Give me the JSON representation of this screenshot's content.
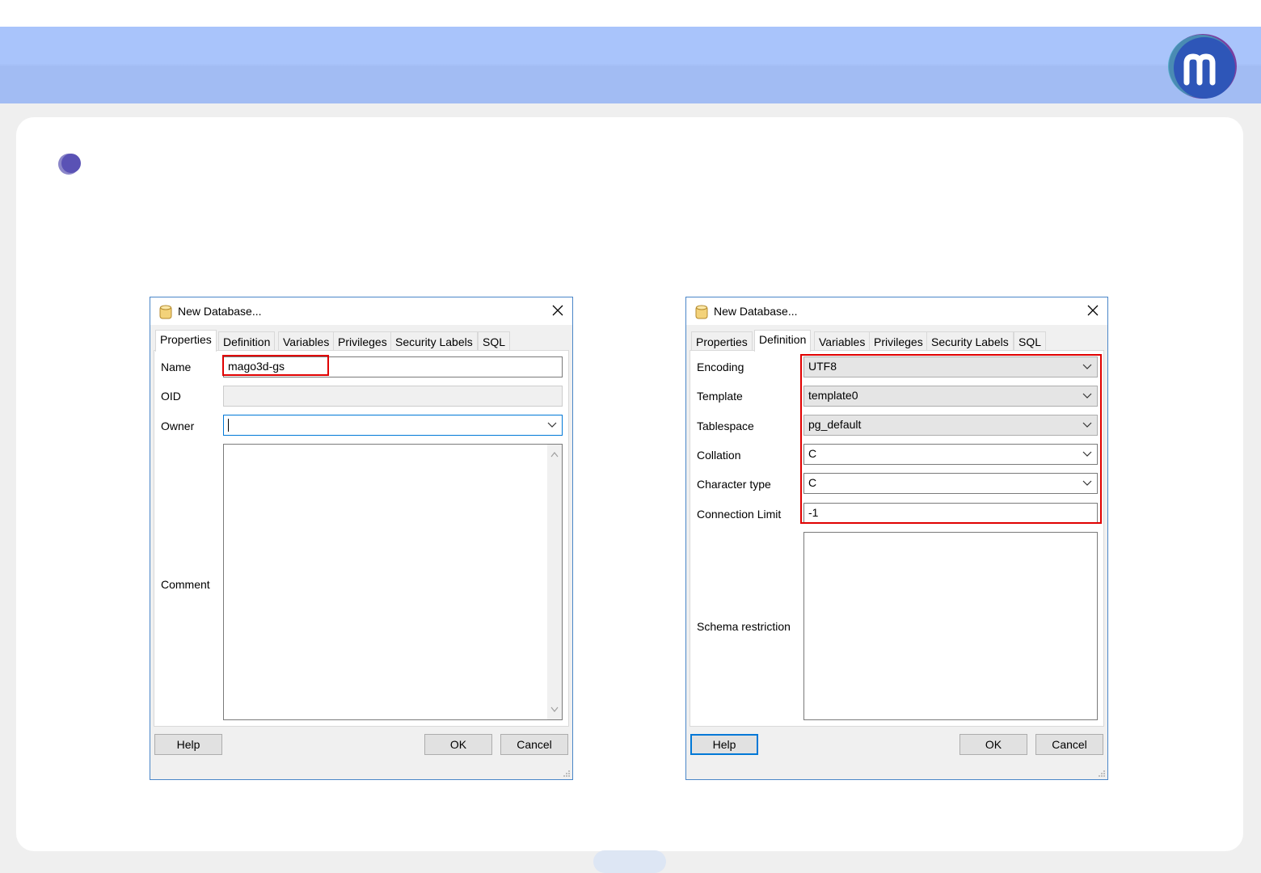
{
  "dialogs": [
    {
      "title": "New Database...",
      "tabs": [
        "Properties",
        "Definition",
        "Variables",
        "Privileges",
        "Security Labels",
        "SQL"
      ],
      "active_tab": "Properties",
      "fields": {
        "name_label": "Name",
        "name_value": "mago3d-gs",
        "oid_label": "OID",
        "oid_value": "",
        "owner_label": "Owner",
        "owner_value": "",
        "comment_label": "Comment"
      },
      "buttons": {
        "help": "Help",
        "ok": "OK",
        "cancel": "Cancel"
      }
    },
    {
      "title": "New Database...",
      "tabs": [
        "Properties",
        "Definition",
        "Variables",
        "Privileges",
        "Security Labels",
        "SQL"
      ],
      "active_tab": "Definition",
      "fields": {
        "encoding_label": "Encoding",
        "encoding_value": "UTF8",
        "template_label": "Template",
        "template_value": "template0",
        "tablespace_label": "Tablespace",
        "tablespace_value": "pg_default",
        "collation_label": "Collation",
        "collation_value": "C",
        "ctype_label": "Character type",
        "ctype_value": "C",
        "connlimit_label": "Connection Limit",
        "connlimit_value": "-1",
        "schema_label": "Schema restriction"
      },
      "buttons": {
        "help": "Help",
        "ok": "OK",
        "cancel": "Cancel"
      }
    }
  ],
  "colors": {
    "banner": "#a9c4fb",
    "highlight_red": "#e00000",
    "focus_blue": "#0078d7"
  }
}
